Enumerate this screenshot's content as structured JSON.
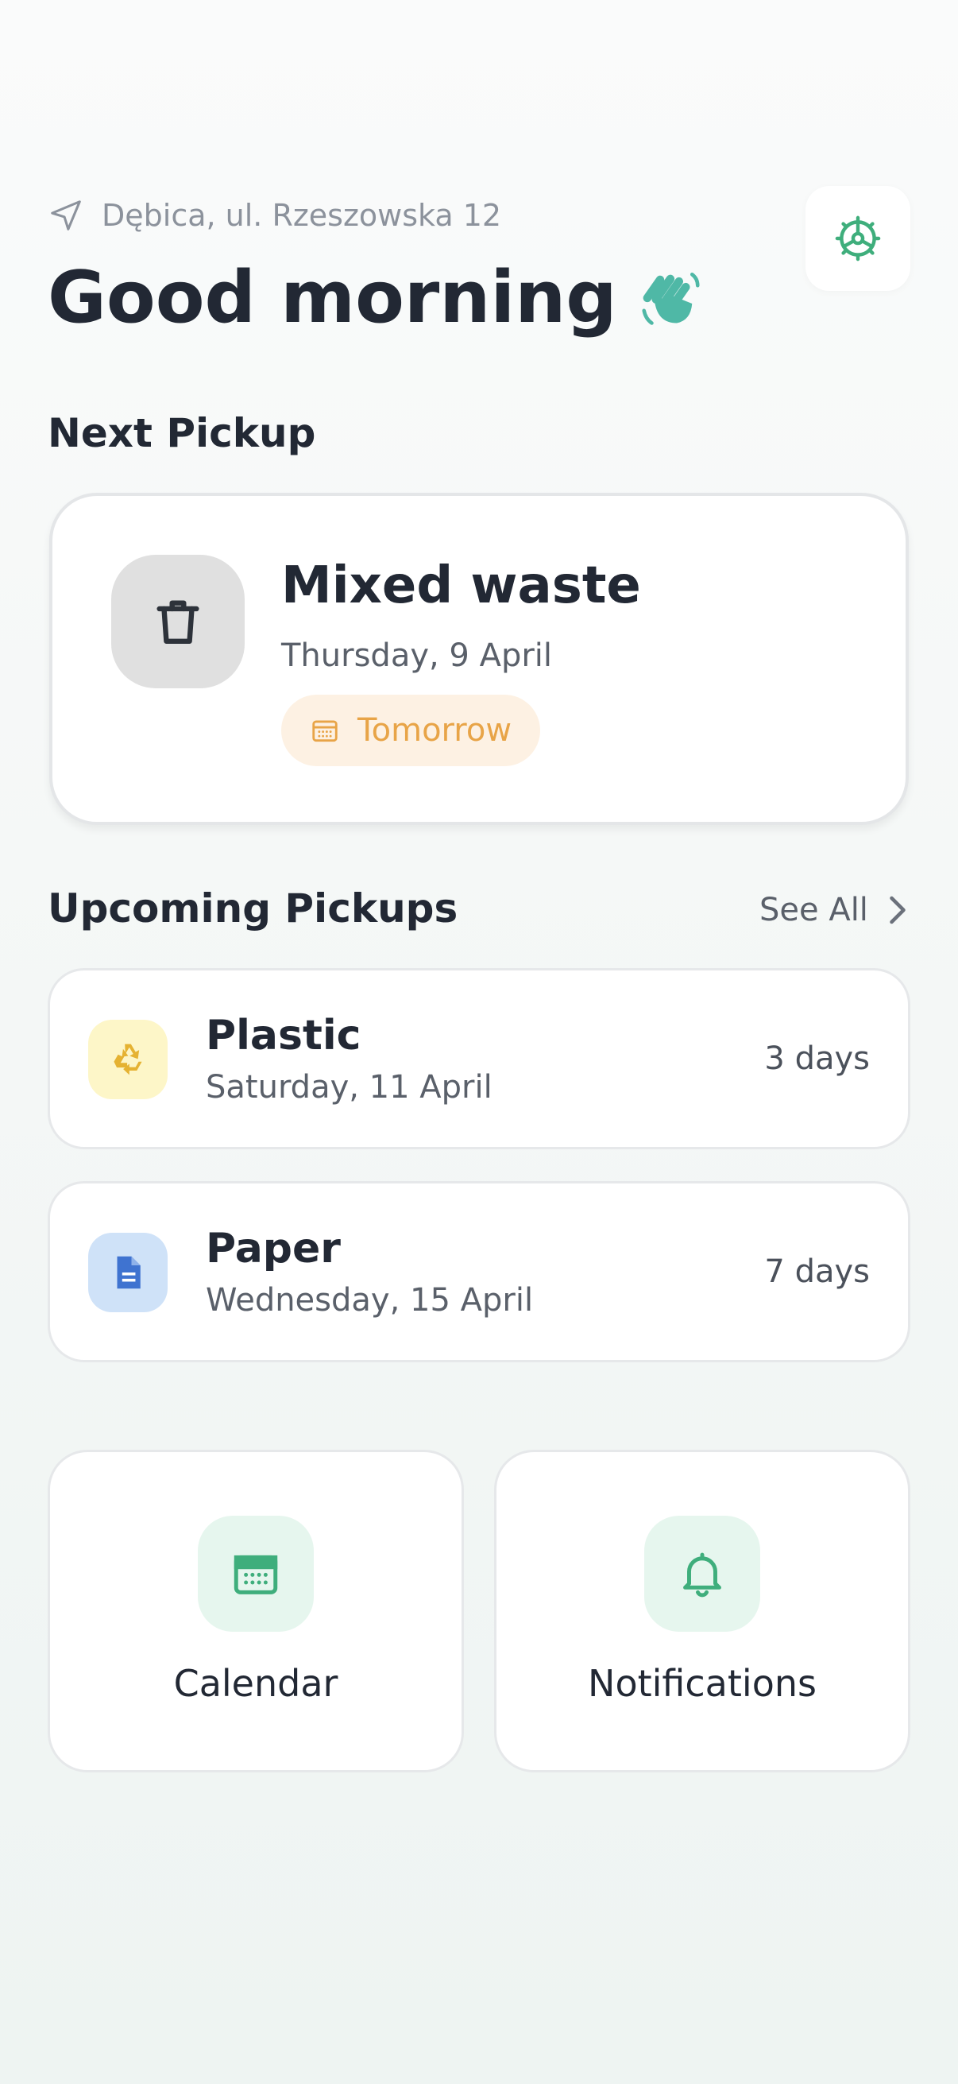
{
  "header": {
    "location": "Dębica, ul. Rzeszowska 12",
    "greeting": "Good morning",
    "location_icon": "navigation-arrow-icon",
    "settings_icon": "gear-icon",
    "greeting_icon": "waving-hand-icon"
  },
  "next_pickup": {
    "section_title": "Next Pickup",
    "title": "Mixed waste",
    "date": "Thursday, 9 April",
    "badge": "Tomorrow",
    "icon": "trash-bin-icon"
  },
  "upcoming": {
    "section_title": "Upcoming Pickups",
    "see_all": "See All",
    "items": [
      {
        "name": "Plastic",
        "date": "Saturday, 11 April",
        "days": "3 days",
        "icon": "recycle-icon",
        "icon_bg": "#fdf6c8"
      },
      {
        "name": "Paper",
        "date": "Wednesday, 15 April",
        "days": "7 days",
        "icon": "document-icon",
        "icon_bg": "#cfe2f8"
      }
    ]
  },
  "tiles": [
    {
      "label": "Calendar",
      "icon": "calendar-icon"
    },
    {
      "label": "Notifications",
      "icon": "bell-icon"
    }
  ],
  "colors": {
    "accent_green": "#3fae7c",
    "badge_orange": "#e8a447",
    "badge_bg": "#fdf1e3"
  }
}
